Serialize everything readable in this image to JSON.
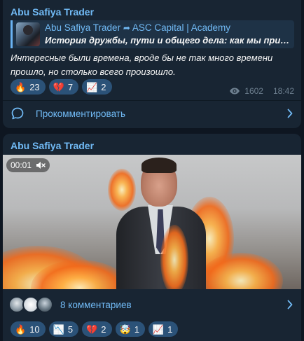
{
  "post1": {
    "author": "Abu Safiya Trader",
    "reply": {
      "title_from": "Abu Safiya Trader",
      "title_to": "ASC Capital | Academy",
      "arrow": "➦",
      "text": "История дружбы, пути и общего дела: как мы пришл..."
    },
    "body": "Интересные были времена, вроде бы не так много времени прошло, но столько всего произошло.",
    "reactions": [
      {
        "emoji": "🔥",
        "count": "23"
      },
      {
        "emoji": "💔",
        "count": "7"
      },
      {
        "emoji": "📈",
        "count": "2"
      }
    ],
    "views": "1602",
    "time": "18:42",
    "comment_label": "Прокомментировать"
  },
  "post2": {
    "author": "Abu Safiya Trader",
    "video_time": "00:01",
    "comment_label": "8 комментариев",
    "reactions": [
      {
        "emoji": "🔥",
        "count": "10"
      },
      {
        "emoji": "📉",
        "count": "5"
      },
      {
        "emoji": "💔",
        "count": "2"
      },
      {
        "emoji": "🤯",
        "count": "1"
      },
      {
        "emoji": "📈",
        "count": "1"
      }
    ]
  },
  "colors": {
    "background": "#0e1621",
    "bubble": "#182533",
    "accent": "#71baf5",
    "reaction_bg": "#2b5278",
    "meta": "#6d7f8f"
  }
}
